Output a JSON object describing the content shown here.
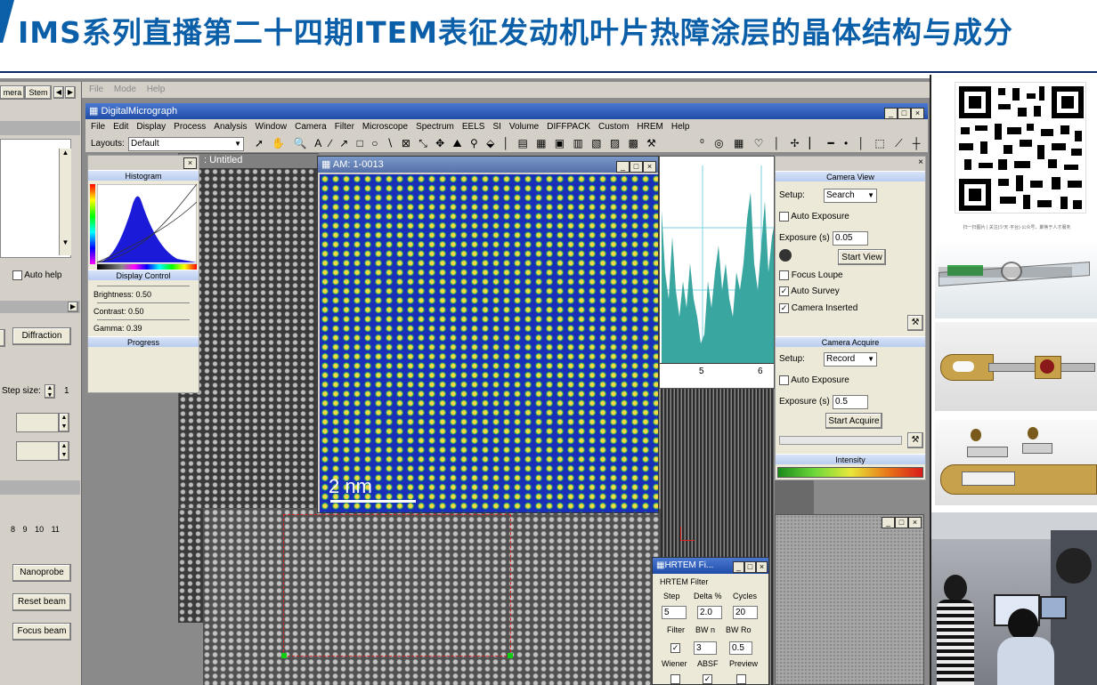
{
  "banner": {
    "title": "IMS系列直播第二十四期ITEM表征发动机叶片热障涂层的晶体结构与成分"
  },
  "bg_menu": [
    "File",
    "Mode",
    "Help"
  ],
  "left_tabs": [
    "mera",
    "Stem"
  ],
  "left_panel": {
    "auto_help": "Auto help",
    "diffraction": "Diffraction",
    "step_size": "Step size:",
    "step_value": "1",
    "ticks": [
      "8",
      "9",
      "10",
      "11"
    ],
    "nanoprobe": "Nanoprobe",
    "reset_beam": "Reset beam",
    "focus_beam": "Focus beam"
  },
  "app": {
    "title": "DigitalMicrograph",
    "menu": [
      "File",
      "Edit",
      "Display",
      "Process",
      "Analysis",
      "Window",
      "Camera",
      "Filter",
      "Microscope",
      "Spectrum",
      "EELS",
      "SI",
      "Volume",
      "DIFFPACK",
      "Custom",
      "HREM",
      "Help"
    ],
    "layouts_label": "Layouts:",
    "layouts_value": "Default"
  },
  "float_panel": {
    "histogram": "Histogram",
    "display_control": "Display Control",
    "brightness": "Brightness: 0.50",
    "contrast": "Contrast: 0.50",
    "gamma": "Gamma: 0.39",
    "progress": "Progress"
  },
  "untitled_title": ": Untitled",
  "am_window": {
    "title": "AM: 1-0013",
    "scale": "2 nm"
  },
  "profile": {
    "ticks": [
      "5",
      "6"
    ]
  },
  "camera_view": {
    "header": "Camera View",
    "setup_label": "Setup:",
    "setup_value": "Search",
    "auto_exposure": "Auto Exposure",
    "exposure_label": "Exposure (s)",
    "exposure_value": "0.05",
    "start_view": "Start View",
    "focus_loupe": "Focus Loupe",
    "auto_survey": "Auto Survey",
    "camera_inserted": "Camera Inserted"
  },
  "camera_acquire": {
    "header": "Camera Acquire",
    "setup_label": "Setup:",
    "setup_value": "Record",
    "auto_exposure": "Auto Exposure",
    "exposure_label": "Exposure (s)",
    "exposure_value": "0.5",
    "start_acquire": "Start Acquire"
  },
  "intensity": {
    "header": "Intensity"
  },
  "hrtem": {
    "title": "HRTEM Fi...",
    "group": "HRTEM Filter",
    "labels1": [
      "Step",
      "Delta %",
      "Cycles"
    ],
    "values1": [
      "5",
      "2.0",
      "20"
    ],
    "labels2": [
      "Filter",
      "BW n",
      "BW Ro"
    ],
    "values2": [
      "3",
      "0.5"
    ],
    "labels3": [
      "Wiener",
      "ABSF",
      "Preview"
    ]
  },
  "qr": {
    "caption": "扫一扫图片 | 关注(少天·平台)·公众号，聚焦于人才服务"
  }
}
